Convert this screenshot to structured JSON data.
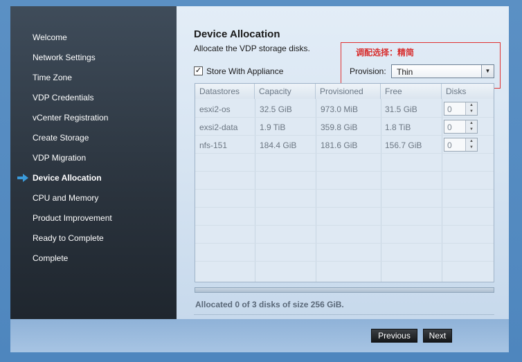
{
  "sidebar": {
    "items": [
      {
        "label": "Welcome"
      },
      {
        "label": "Network Settings"
      },
      {
        "label": "Time Zone"
      },
      {
        "label": "VDP Credentials"
      },
      {
        "label": "vCenter Registration"
      },
      {
        "label": "Create Storage"
      },
      {
        "label": "VDP Migration"
      },
      {
        "label": "Device Allocation"
      },
      {
        "label": "CPU and Memory"
      },
      {
        "label": "Product Improvement"
      },
      {
        "label": "Ready to Complete"
      },
      {
        "label": "Complete"
      }
    ],
    "active_index": 7
  },
  "main": {
    "title": "Device Allocation",
    "subtitle": "Allocate the VDP storage disks.",
    "store_with_appliance": {
      "label": "Store With Appliance",
      "checked": true
    },
    "annotation": "调配选择：精简",
    "provision": {
      "label": "Provision:",
      "value": "Thin"
    },
    "table": {
      "headers": [
        "Datastores",
        "Capacity",
        "Provisioned",
        "Free",
        "Disks"
      ],
      "rows": [
        {
          "datastore": "esxi2-os",
          "capacity": "32.5 GiB",
          "provisioned": "973.0 MiB",
          "free": "31.5 GiB",
          "disks": "0"
        },
        {
          "datastore": "exsi2-data",
          "capacity": "1.9 TiB",
          "provisioned": "359.8 GiB",
          "free": "1.8 TiB",
          "disks": "0"
        },
        {
          "datastore": "nfs-151",
          "capacity": "184.4 GiB",
          "provisioned": "181.6 GiB",
          "free": "156.7 GiB",
          "disks": "0"
        }
      ]
    },
    "allocated_text": "Allocated 0 of 3 disks of size 256 GiB."
  },
  "footer": {
    "previous_label": "Previous",
    "next_label": "Next"
  },
  "colors": {
    "accent_arrow": "#3a9ad9",
    "annotation_red": "#d83030"
  }
}
